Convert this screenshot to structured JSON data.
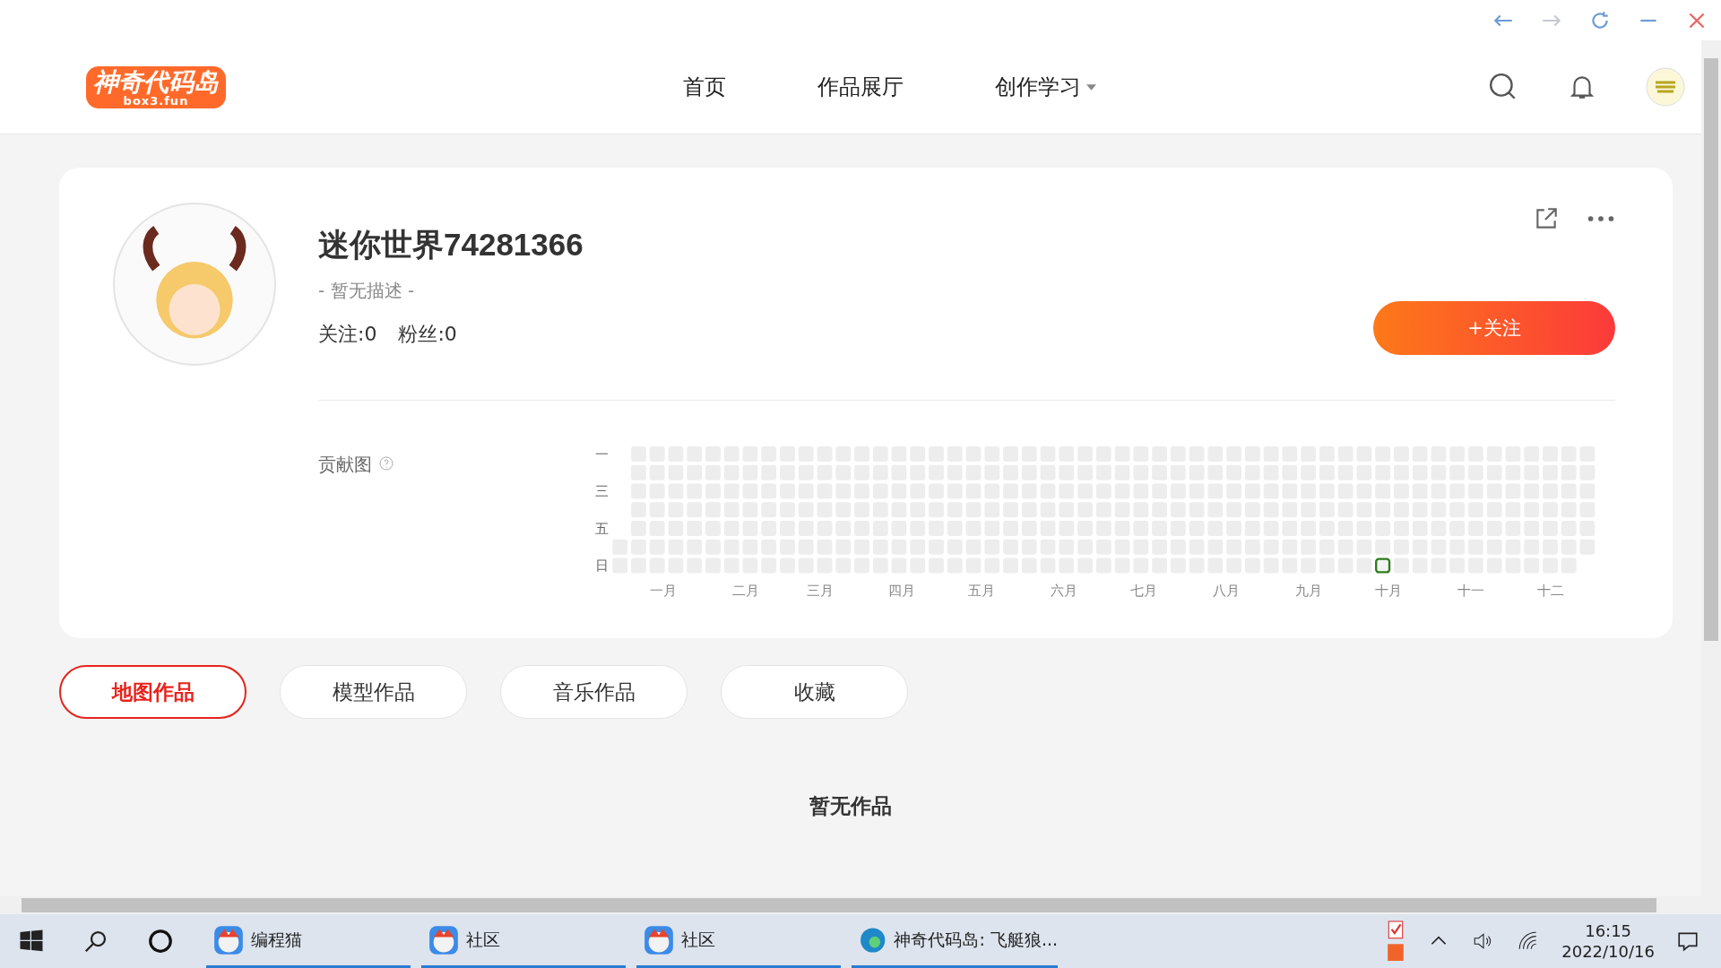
{
  "header": {
    "logo": {
      "title": "神奇代码岛",
      "subtitle": "box3.fun"
    },
    "nav": [
      {
        "label": "首页",
        "dropdown": false
      },
      {
        "label": "作品展厅",
        "dropdown": false
      },
      {
        "label": "创作学习",
        "dropdown": true
      }
    ]
  },
  "profile": {
    "name": "迷你世界74281366",
    "description": "- 暂无描述 -",
    "following": "关注:0",
    "followers": "粉丝:0",
    "follow_button": "+关注"
  },
  "contribution": {
    "title": "贡献图",
    "weekday_labels": [
      "一",
      "三",
      "五",
      "日"
    ],
    "months": [
      "一月",
      "二月",
      "三月",
      "四月",
      "五月",
      "六月",
      "七月",
      "八月",
      "九月",
      "十月",
      "十一",
      "十二"
    ]
  },
  "tabs": [
    {
      "label": "地图作品",
      "selected": true
    },
    {
      "label": "模型作品",
      "selected": false
    },
    {
      "label": "音乐作品",
      "selected": false
    },
    {
      "label": "收藏",
      "selected": false
    }
  ],
  "empty_message": "暂无作品",
  "taskbar": {
    "apps": [
      {
        "kind": "mascot",
        "label": "编程猫"
      },
      {
        "kind": "mascot",
        "label": "社区"
      },
      {
        "kind": "mascot",
        "label": "社区"
      },
      {
        "kind": "browser",
        "label": "神奇代码岛: 飞艇狼..."
      }
    ],
    "time": "16:15",
    "date": "2022/10/16"
  }
}
